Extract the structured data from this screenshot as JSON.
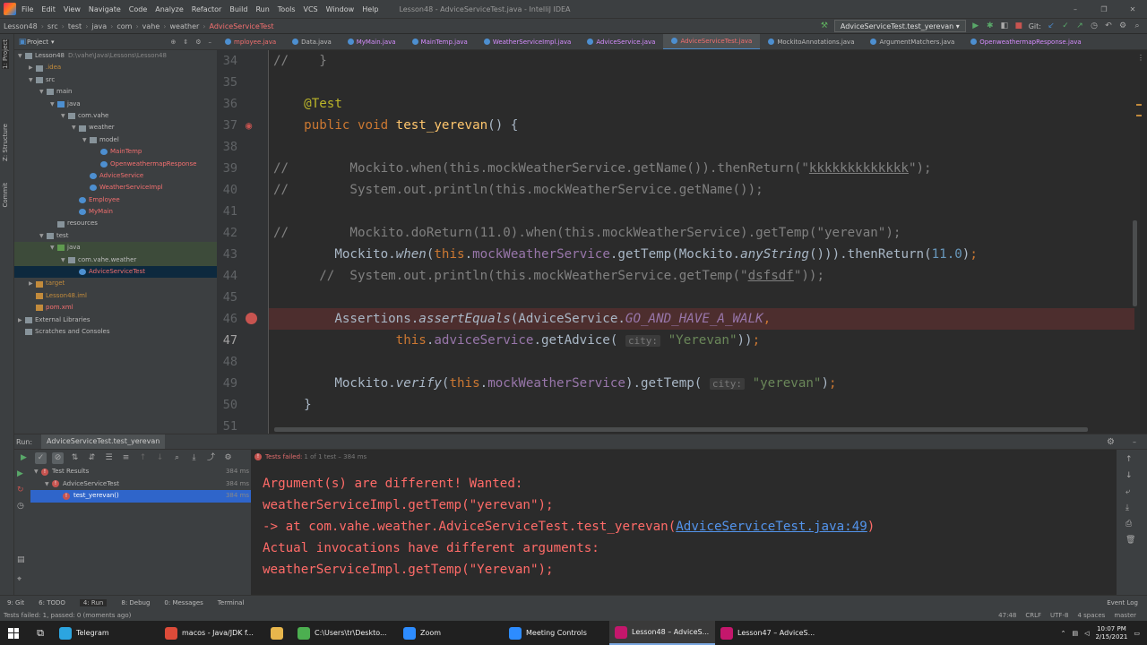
{
  "menubar": {
    "items": [
      "File",
      "Edit",
      "View",
      "Navigate",
      "Code",
      "Analyze",
      "Refactor",
      "Build",
      "Run",
      "Tools",
      "VCS",
      "Window",
      "Help"
    ],
    "title": "Lesson48 - AdviceServiceTest.java - IntelliJ IDEA"
  },
  "navbar": {
    "crumbs": [
      "Lesson48",
      "src",
      "test",
      "java",
      "com",
      "vahe",
      "weather",
      "AdviceServiceTest"
    ],
    "run_config": "AdviceServiceTest.test_yerevan",
    "git_label": "Git:"
  },
  "leftstrip": {
    "labels": [
      "1: Project",
      "Z: Structure",
      "Commit"
    ]
  },
  "project": {
    "header": "Project",
    "tree": [
      {
        "label": "Lesson48",
        "extra": "D:\\vahe\\Java\\Lessons\\Lesson48",
        "indent": 0,
        "arrow": "▼",
        "icon": "folder",
        "color": "#bbbbbb"
      },
      {
        "label": ".idea",
        "indent": 1,
        "arrow": "▶",
        "icon": "folder",
        "color": "#c28b3c"
      },
      {
        "label": "src",
        "indent": 1,
        "arrow": "▼",
        "icon": "folder",
        "color": "#bbbbbb"
      },
      {
        "label": "main",
        "indent": 2,
        "arrow": "▼",
        "icon": "folder",
        "color": "#bbbbbb"
      },
      {
        "label": "java",
        "indent": 3,
        "arrow": "▼",
        "icon": "src",
        "color": "#bbbbbb"
      },
      {
        "label": "com.vahe",
        "indent": 4,
        "arrow": "▼",
        "icon": "folder",
        "color": "#bbbbbb"
      },
      {
        "label": "weather",
        "indent": 5,
        "arrow": "▼",
        "icon": "folder",
        "color": "#bbbbbb"
      },
      {
        "label": "model",
        "indent": 6,
        "arrow": "▼",
        "icon": "folder",
        "color": "#bbbbbb"
      },
      {
        "label": "MainTemp",
        "indent": 7,
        "arrow": "",
        "icon": "cls",
        "color": "#f26f6f"
      },
      {
        "label": "OpenweathermapResponse",
        "indent": 7,
        "arrow": "",
        "icon": "cls",
        "color": "#f26f6f"
      },
      {
        "label": "AdviceService",
        "indent": 6,
        "arrow": "",
        "icon": "cls",
        "color": "#f26f6f"
      },
      {
        "label": "WeatherServiceImpl",
        "indent": 6,
        "arrow": "",
        "icon": "cls",
        "color": "#f26f6f"
      },
      {
        "label": "Employee",
        "indent": 5,
        "arrow": "",
        "icon": "cls",
        "color": "#f26f6f"
      },
      {
        "label": "MyMain",
        "indent": 5,
        "arrow": "",
        "icon": "cls",
        "color": "#f26f6f"
      },
      {
        "label": "resources",
        "indent": 3,
        "arrow": "",
        "icon": "folder",
        "color": "#bbbbbb"
      },
      {
        "label": "test",
        "indent": 2,
        "arrow": "▼",
        "icon": "folder",
        "color": "#bbbbbb"
      },
      {
        "label": "java",
        "indent": 3,
        "arrow": "▼",
        "icon": "test",
        "color": "#bbbbbb",
        "hl": true
      },
      {
        "label": "com.vahe.weather",
        "indent": 4,
        "arrow": "▼",
        "icon": "folder",
        "color": "#bbbbbb",
        "hl": true
      },
      {
        "label": "AdviceServiceTest",
        "indent": 5,
        "arrow": "",
        "icon": "cls",
        "color": "#f26f6f",
        "sel": true
      },
      {
        "label": "target",
        "indent": 1,
        "arrow": "▶",
        "icon": "orange",
        "color": "#c28b3c"
      },
      {
        "label": "Lesson48.iml",
        "indent": 1,
        "arrow": "",
        "icon": "orange",
        "color": "#c28b3c"
      },
      {
        "label": "pom.xml",
        "indent": 1,
        "arrow": "",
        "icon": "orange",
        "color": "#f26f6f"
      },
      {
        "label": "External Libraries",
        "indent": 0,
        "arrow": "▶",
        "icon": "folder",
        "color": "#bbbbbb"
      },
      {
        "label": "Scratches and Consoles",
        "indent": 0,
        "arrow": "",
        "icon": "folder",
        "color": "#bbbbbb"
      }
    ]
  },
  "tabs": [
    {
      "label": "mployee.java",
      "cls": "red"
    },
    {
      "label": "Data.java",
      "cls": "norm"
    },
    {
      "label": "MyMain.java",
      "cls": ""
    },
    {
      "label": "MainTemp.java",
      "cls": ""
    },
    {
      "label": "WeatherServiceImpl.java",
      "cls": ""
    },
    {
      "label": "AdviceService.java",
      "cls": ""
    },
    {
      "label": "AdviceServiceTest.java",
      "cls": "active red"
    },
    {
      "label": "MockitoAnnotations.java",
      "cls": "norm"
    },
    {
      "label": "ArgumentMatchers.java",
      "cls": "norm"
    },
    {
      "label": "OpenweathermapResponse.java",
      "cls": ""
    }
  ],
  "editor": {
    "line_numbers": [
      "34",
      "35",
      "36",
      "37",
      "38",
      "39",
      "40",
      "41",
      "42",
      "43",
      "44",
      "45",
      "46",
      "47",
      "48",
      "49",
      "50",
      "51"
    ],
    "current_line": "47",
    "breakpoint_line": "46",
    "hint_city": "city:"
  },
  "run": {
    "label": "Run:",
    "tab": "AdviceServiceTest.test_yerevan",
    "status": "Tests failed:",
    "status_detail": "1 of 1 test – 384 ms",
    "tree": [
      {
        "label": "Test Results",
        "dur": "384 ms",
        "indent": 0
      },
      {
        "label": "AdviceServiceTest",
        "dur": "384 ms",
        "indent": 1
      },
      {
        "label": "test_yerevan()",
        "dur": "384 ms",
        "indent": 2,
        "sel": true
      }
    ],
    "console": [
      "Argument(s) are different! Wanted:",
      "weatherServiceImpl.getTemp(\"yerevan\");",
      "-> at com.vahe.weather.AdviceServiceTest.test_yerevan(",
      "Actual invocations have different arguments:",
      "weatherServiceImpl.getTemp(\"Yerevan\");"
    ],
    "console_link": "AdviceServiceTest.java:49",
    "console_link_close": ")"
  },
  "toolstrip": {
    "items": [
      "9: Git",
      "6: TODO",
      "4: Run",
      "8: Debug",
      "0: Messages",
      "Terminal"
    ],
    "active": "4: Run",
    "event_log": "Event Log"
  },
  "statusbar": {
    "message": "Tests failed: 1, passed: 0 (moments ago)",
    "right": [
      "47:48",
      "CRLF",
      "UTF-8",
      "4 spaces",
      "master"
    ]
  },
  "taskbar": {
    "items": [
      {
        "label": "Telegram",
        "color": "#2ca5e0",
        "active": false
      },
      {
        "label": "macos - Java/JDK f...",
        "color": "#dd4b39",
        "active": false
      },
      {
        "label": "",
        "color": "#e8b64c",
        "active": false
      },
      {
        "label": "C:\\Users\\tr\\Deskto...",
        "color": "#4caf50",
        "active": false
      },
      {
        "label": "Zoom",
        "color": "#2d8cff",
        "active": false
      },
      {
        "label": "Meeting Controls",
        "color": "#2d8cff",
        "active": false
      },
      {
        "label": "Lesson48 – AdviceS...",
        "color": "#c4176c",
        "active": true
      },
      {
        "label": "Lesson47 – AdviceS...",
        "color": "#c4176c",
        "active": false
      }
    ],
    "time": "10:07 PM",
    "date": "2/15/2021"
  }
}
